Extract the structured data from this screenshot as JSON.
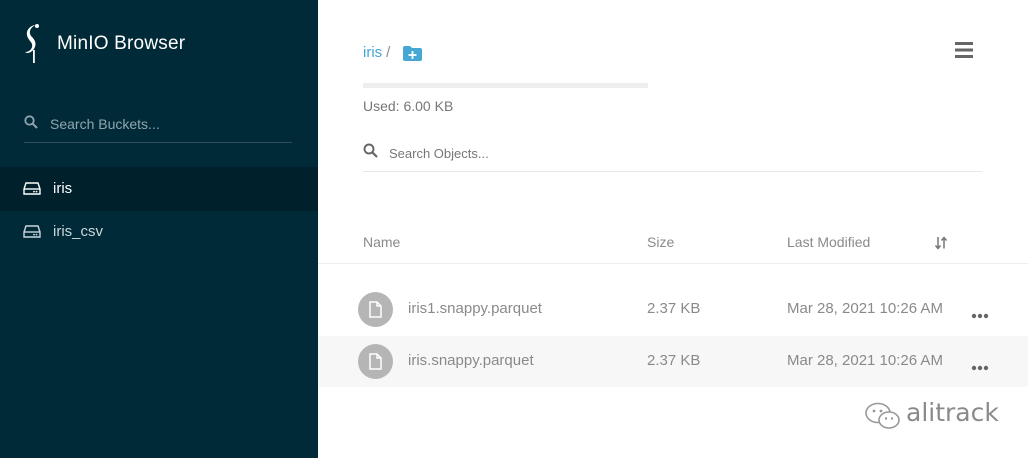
{
  "app": {
    "title": "MinIO Browser"
  },
  "sidebar": {
    "search_placeholder": "Search Buckets...",
    "buckets": [
      {
        "name": "iris",
        "active": true
      },
      {
        "name": "iris_csv",
        "active": false
      }
    ]
  },
  "main": {
    "breadcrumb": {
      "bucket": "iris",
      "separator": "/"
    },
    "usage": {
      "text": "Used: 6.00 KB",
      "fraction": 0.0
    },
    "search_placeholder": "Search Objects...",
    "columns": {
      "name": "Name",
      "size": "Size",
      "modified": "Last Modified"
    },
    "objects": [
      {
        "name": "iris1.snappy.parquet",
        "size": "2.37 KB",
        "modified": "Mar 28, 2021 10:26 AM"
      },
      {
        "name": "iris.snappy.parquet",
        "size": "2.37 KB",
        "modified": "Mar 28, 2021 10:26 AM"
      }
    ]
  },
  "watermark": {
    "text": "alitrack"
  },
  "colors": {
    "sidebar_bg": "#002a37",
    "sidebar_active": "#00212c",
    "accent": "#46a6d4",
    "row_alt": "#f7f7f7"
  },
  "icons": [
    "minio-logo-icon",
    "search-icon",
    "drive-icon",
    "add-folder-icon",
    "hamburger-menu-icon",
    "sort-icon",
    "file-icon",
    "more-icon",
    "wechat-icon"
  ]
}
